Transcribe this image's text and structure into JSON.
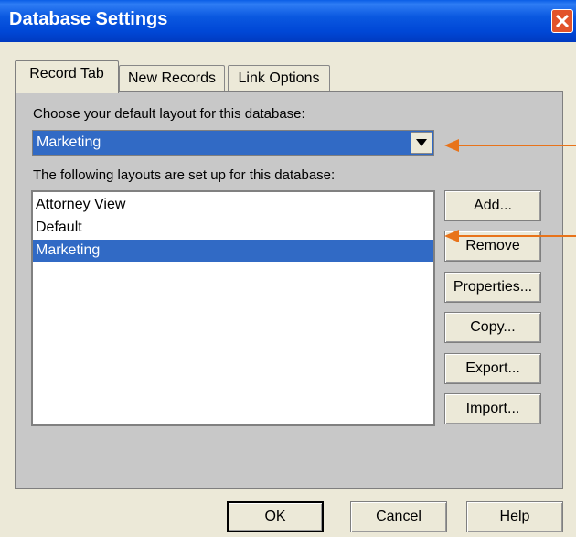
{
  "window": {
    "title": "Database Settings"
  },
  "tabs": [
    {
      "label": "Record Tab",
      "active": true
    },
    {
      "label": "New Records",
      "active": false
    },
    {
      "label": "Link Options",
      "active": false
    }
  ],
  "default_layout": {
    "label": "Choose your default layout for this database:",
    "selected": "Marketing"
  },
  "layouts": {
    "label": "The following layouts are set up for this database:",
    "items": [
      {
        "label": "Attorney View",
        "selected": false
      },
      {
        "label": "Default",
        "selected": false
      },
      {
        "label": "Marketing",
        "selected": true
      }
    ]
  },
  "side_buttons": {
    "add": "Add...",
    "remove": "Remove",
    "properties": "Properties...",
    "copy": "Copy...",
    "export": "Export...",
    "import": "Import..."
  },
  "bottom_buttons": {
    "ok": "OK",
    "cancel": "Cancel",
    "help": "Help"
  },
  "colors": {
    "annotation_arrow": "#e8731a",
    "selection": "#316ac5",
    "titlebar": "#0a58e0"
  }
}
